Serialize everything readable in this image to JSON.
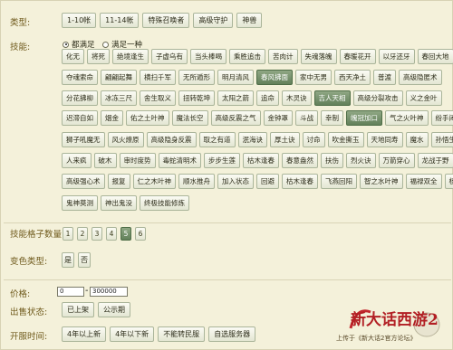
{
  "type_label": "类型:",
  "types": [
    "1-10帐",
    "11-14帐",
    "特殊召唤者",
    "高级守护",
    "神兽"
  ],
  "skill_label": "技能:",
  "skill_modes": {
    "all": "都满足",
    "any": "满足一种"
  },
  "skill_rows": [
    [
      "化无",
      "将死",
      "绝境逢生",
      "子虚乌有",
      "当头棒喝",
      "乘胜追击",
      "苦肉计",
      "失魂落魄",
      "春暖花开",
      "以牙还牙",
      "春回大地"
    ],
    [
      "夺魂索命",
      "翩翩起舞",
      "横扫千军",
      "无所遁形",
      "明月清风",
      "春风拂面",
      "家中无男",
      "西天净土",
      "普渡",
      "高级隐匿术"
    ],
    [
      "分花拂柳",
      "冰冻三尺",
      "舍生取义",
      "扭转乾坤",
      "太阳之箭",
      "追命",
      "木灵诀",
      "吉人天相",
      "高级分裂攻击",
      "义之金叶"
    ],
    [
      "迟滞自如",
      "烟金",
      "佑之土叶神",
      "魔法长空",
      "高级反震之气",
      "金钟罩",
      "斗战",
      "幸制",
      "魄冠加口",
      "气之火叶神",
      "纷手闭罚"
    ],
    [
      "狮子吼魔无",
      "风火燎原",
      "高级隐身反震",
      "取之有道",
      "泯海诀",
      "厚土诀",
      "讨命",
      "吹金撕玉",
      "天地同寿",
      "魔水",
      "孙悟生体"
    ],
    [
      "人来疯",
      "破木",
      "审时度势",
      "毒蛇清明术",
      "步步生莲",
      "枯木逢春",
      "春意盎然",
      "扶伤",
      "烈火诀",
      "万箭穿心",
      "龙战于野"
    ],
    [
      "高级强心术",
      "报复",
      "仁之木叶神",
      "顺水推舟",
      "加入状态",
      "回避",
      "枯木逢春",
      "飞燕回阳",
      "智之水叶神",
      "福禄双全",
      "核火"
    ],
    [
      "鬼神莫测",
      "神出鬼没",
      "终极技能修炼"
    ]
  ],
  "selected_skills": [
    "春风拂面",
    "吉人天相",
    "魄冠加口"
  ],
  "slot_label": "技能格子数量:",
  "slots": [
    "1",
    "2",
    "3",
    "4",
    "5",
    "6"
  ],
  "selected_slot": "5",
  "variant_label": "变色类型:",
  "variants": [
    "是",
    "否"
  ],
  "price_label": "价格:",
  "price_min": "0",
  "price_max": "300000",
  "price_sep": "-",
  "status_label": "出售状态:",
  "statuses": [
    "已上架",
    "公示期"
  ],
  "time_label": "开服时间:",
  "times": [
    "4年以上新",
    "4年以下新",
    "不能转民服",
    "自选服务器"
  ],
  "logo": {
    "title": "新大话西游2",
    "subtitle": "上传于《新大话2官方论坛》"
  }
}
